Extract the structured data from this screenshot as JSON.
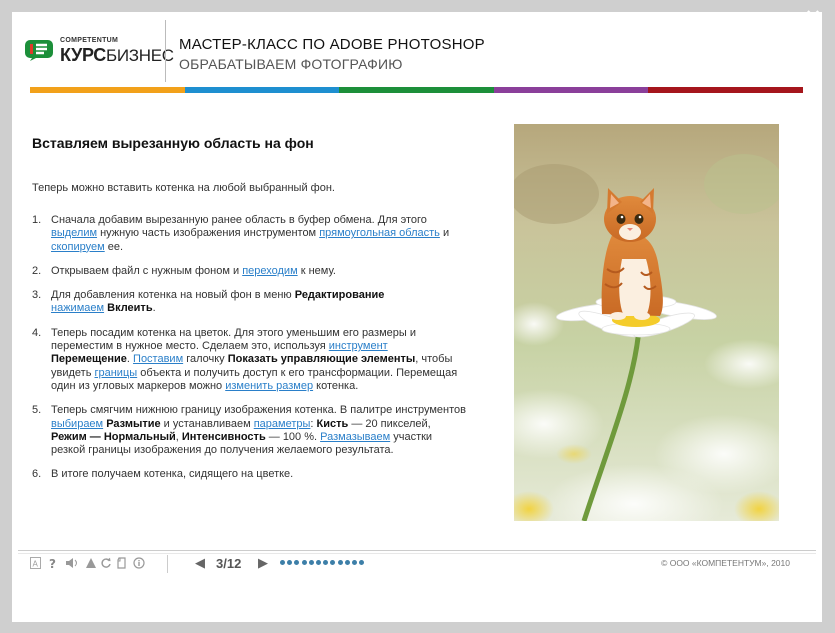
{
  "window": {
    "close_label": "✖"
  },
  "header": {
    "logo_small": "COMPETENTUM",
    "logo_bold": "КУРС",
    "logo_thin": "БИЗНЕС",
    "title": "МАСТЕР-КЛАСС ПО ADOBE PHOTOSHOP",
    "subtitle": "ОБРАБАТЫВАЕМ ФОТОГРАФИЮ"
  },
  "content": {
    "heading": "Вставляем вырезанную область на фон",
    "intro": "Теперь можно вставить котенка на любой выбранный фон.",
    "steps": [
      {
        "num": "1.",
        "t1": "Сначала добавим вырезанную ранее область в буфер обмена. Для этого ",
        "l1": "выделим",
        "t2": " нужную часть изображения инструментом ",
        "l2": "прямоугольная область",
        "t3": " и ",
        "l3": "скопируем",
        "t4": " ее."
      },
      {
        "num": "2.",
        "t1": "Открываем файл с нужным фоном и ",
        "l1": "переходим",
        "t2": " к нему."
      },
      {
        "num": "3.",
        "t1": "Для добавления котенка на новый фон в меню ",
        "b1": "Редактирование",
        "l1": "нажимаем",
        "t2": " ",
        "b2": "Вклеить",
        "t3": "."
      },
      {
        "num": "4.",
        "t1": "Теперь посадим котенка на цветок. Для этого уменьшим его размеры и переместим в нужное место. Сделаем это, используя ",
        "l1": "инструмент",
        "b1": "Перемещение",
        "t2": ". ",
        "l2": "Поставим",
        "t3": " галочку ",
        "b2": "Показать управляющие элементы",
        "t4": ", чтобы увидеть ",
        "l3": "границы",
        "t5": " объекта и получить доступ к его трансформации. Перемещая один из угловых маркеров можно ",
        "l4": "изменить размер",
        "t6": " котенка."
      },
      {
        "num": "5.",
        "t1": "Теперь смягчим нижнюю границу изображения котенка. В палитре инструментов ",
        "l1": "выбираем",
        "t2": " ",
        "b1": "Размытие",
        "t3": " и устанавливаем ",
        "l2": "параметры",
        "t4": ": ",
        "b2": "Кисть",
        "t5": " — 20 пикселей, ",
        "b3": "Режим — Нормальный",
        "t6": ", ",
        "b4": "Интенсивность",
        "t7": " — 100 %. ",
        "l3": "Размазываем",
        "t8": " участки резкой границы изображения до получения желаемого результата."
      },
      {
        "num": "6.",
        "t1": "В итоге получаем котенка, сидящего на цветке."
      }
    ]
  },
  "footer": {
    "prev": "◀",
    "next": "▶",
    "current": "3",
    "total": "12",
    "copyright": "© ООО «КОМПЕТЕНТУМ», 2010",
    "icons": [
      "font-size-icon",
      "help-icon",
      "sound-icon",
      "triangle-icon",
      "refresh-icon",
      "print-icon",
      "info-icon"
    ]
  },
  "colors": {
    "link": "#2a7fc9",
    "dot": "#3d7fa8"
  }
}
